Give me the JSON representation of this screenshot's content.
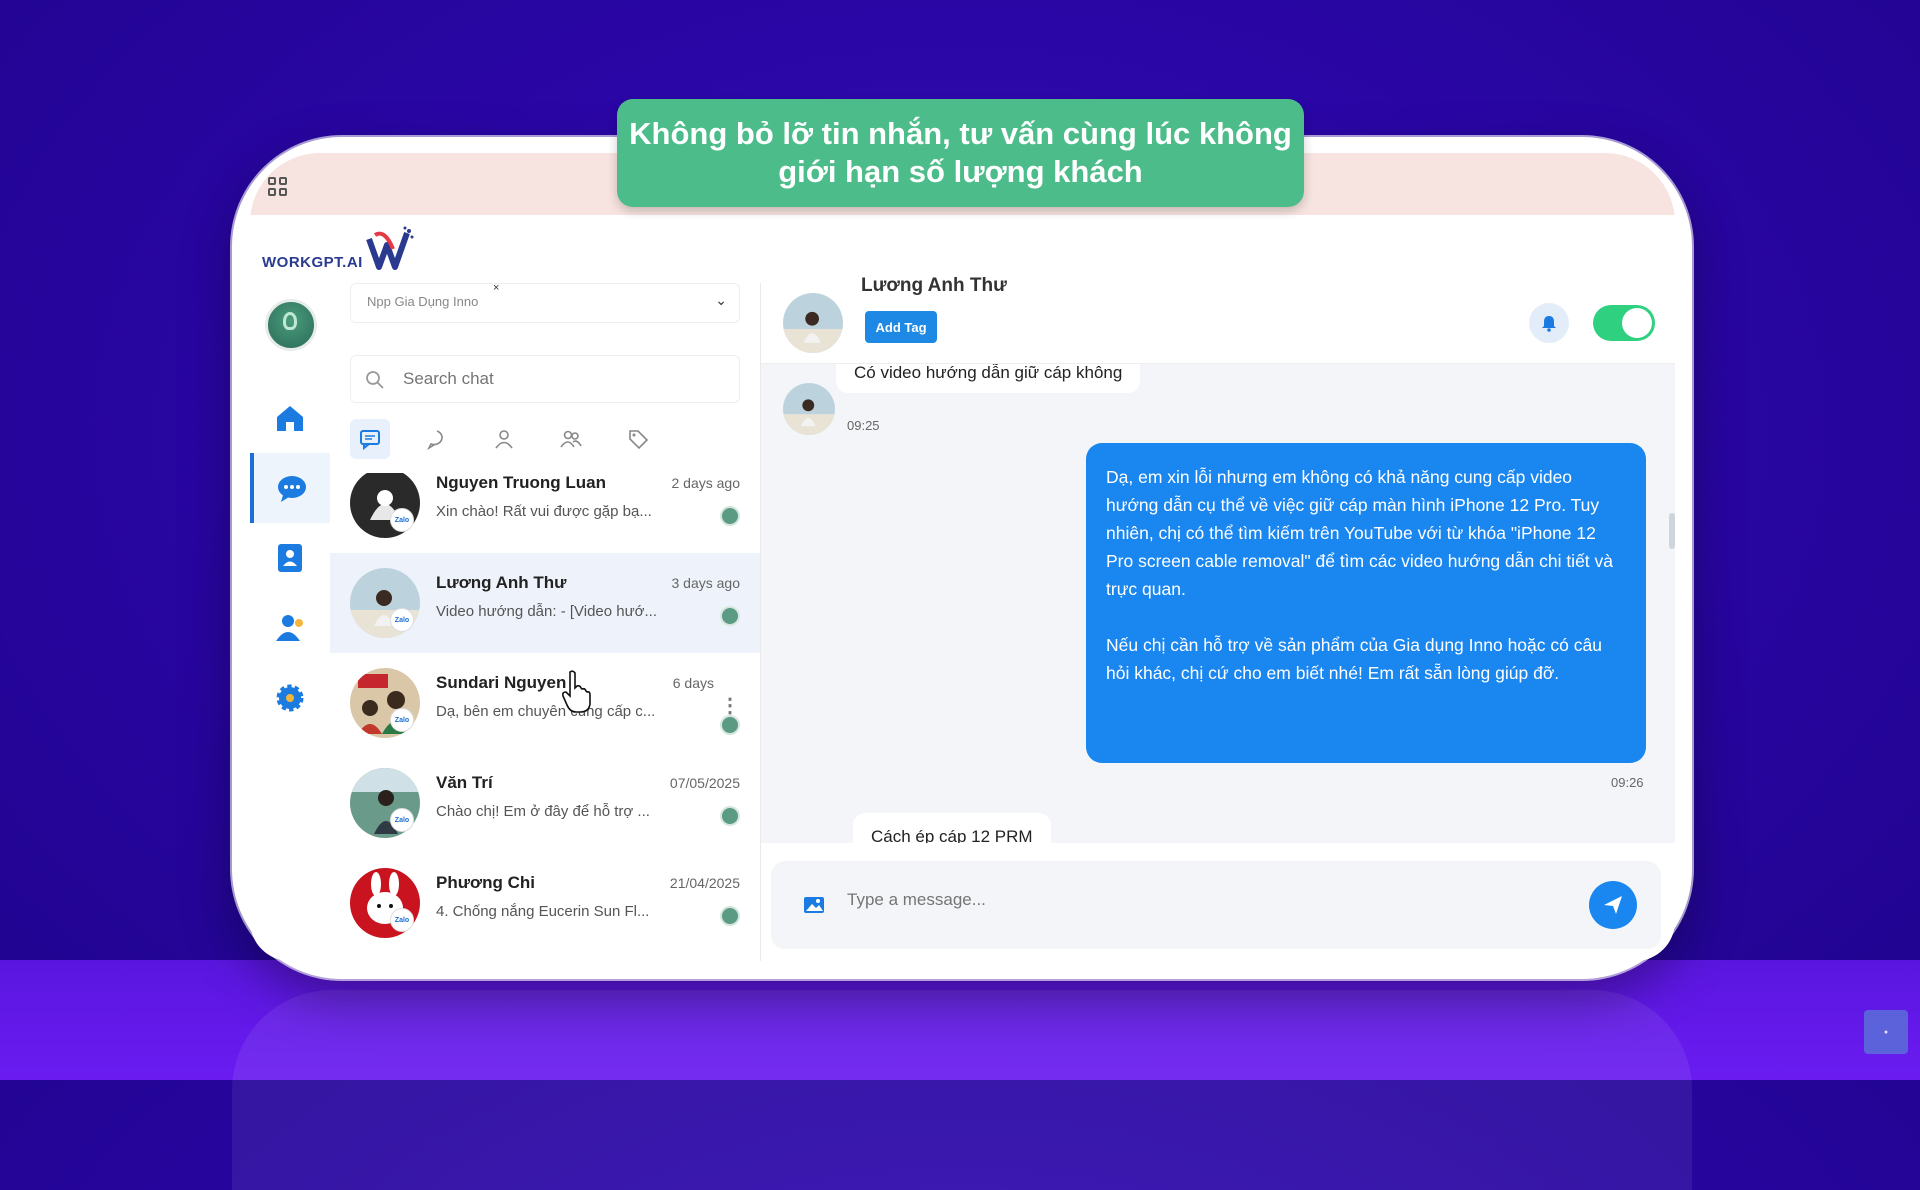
{
  "banner": {
    "line1": "Không bỏ lỡ tin nhắn, tư vấn cùng lúc không",
    "line2": "giới hạn số lượng khách"
  },
  "brand": {
    "logo_text": "WORKGPT.AI"
  },
  "sidebar": {
    "items": [
      {
        "icon": "home-icon"
      },
      {
        "icon": "chat-icon",
        "active": true
      },
      {
        "icon": "contacts-icon"
      },
      {
        "icon": "user-icon"
      },
      {
        "icon": "settings-icon"
      }
    ]
  },
  "chatlist": {
    "page_select": {
      "value": "Npp Gia Dụng Inno",
      "clear": "×"
    },
    "search": {
      "placeholder": "Search chat"
    },
    "filter_tabs": [
      "all-messages-icon",
      "comment-icon",
      "person-icon",
      "group-icon",
      "tag-icon"
    ],
    "conversations": [
      {
        "name": "Nguyen Truong Luan",
        "preview": "Xin chào! Rất vui được gặp bạ...",
        "time": "2 days ago"
      },
      {
        "name": "Lương Anh Thư",
        "preview": "Video hướng dẫn: - [Video hướ...",
        "time": "3 days ago",
        "active": true
      },
      {
        "name": "Sundari Nguyen",
        "preview": "Dạ, bên em chuyên cung cấp c...",
        "time": "6 days",
        "more": "⋮"
      },
      {
        "name": "Văn Trí",
        "preview": "Chào chị! Em ở đây để hỗ trợ ...",
        "time": "07/05/2025"
      },
      {
        "name": "Phương Chi",
        "preview": "4. Chống nắng Eucerin Sun Fl...",
        "time": "21/04/2025"
      }
    ]
  },
  "chat": {
    "contact_name": "Lương Anh Thư",
    "add_tag_label": "Add Tag",
    "messages": [
      {
        "direction": "in",
        "text": "Có video hướng dẫn giữ cáp không",
        "time": "09:25"
      },
      {
        "direction": "out",
        "text": "Dạ, em xin lỗi nhưng em không có khả năng cung cấp video hướng dẫn cụ thể về việc giữ cáp màn hình iPhone 12 Pro. Tuy nhiên, chị có thể tìm kiếm trên YouTube với từ khóa \"iPhone 12 Pro screen cable removal\" để tìm các video hướng dẫn chi tiết và trực quan.\n\nNếu chị cần hỗ trợ về sản phẩm của Gia dụng Inno hoặc có câu hỏi khác, chị cứ cho em biết nhé! Em rất sẵn lòng giúp đỡ.",
        "time": "09:26"
      },
      {
        "direction": "in",
        "text": "Cách ép cáp 12 PRM"
      }
    ],
    "composer": {
      "placeholder": "Type a message..."
    },
    "notifications_on": true
  },
  "colors": {
    "primary": "#1a86ef",
    "banner": "#4cbc8a",
    "toggle": "#2fd07f",
    "background": "#2a06a6"
  }
}
